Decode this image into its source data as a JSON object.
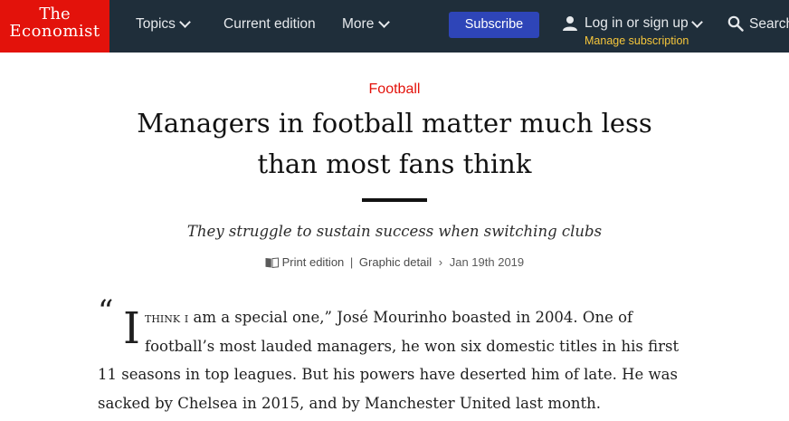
{
  "header": {
    "logo_line1": "The",
    "logo_line2": "Economist",
    "nav": {
      "topics": "Topics",
      "current_edition": "Current edition",
      "more": "More"
    },
    "subscribe": "Subscribe",
    "login": "Log in or sign up",
    "manage": "Manage subscription",
    "search": "Search",
    "colors": {
      "bar": "#1f2e3a",
      "logo": "#e3120b",
      "subscribe": "#2e45b8",
      "manage": "#f6c63b"
    },
    "icons": [
      "chevron-down-icon",
      "user-icon",
      "search-icon"
    ]
  },
  "article": {
    "section": "Football",
    "headline_line1": "Managers in football matter much less",
    "headline_line2": "than most fans think",
    "standfirst": "They struggle to sustain success when switching clubs",
    "meta": {
      "print": "Print edition",
      "sep": "|",
      "graphic": "Graphic detail",
      "arrow": "›",
      "date": "Jan 19th 2019",
      "icon": "book-icon"
    },
    "body": {
      "open_quote": "“",
      "dropcap": "I",
      "line1_smallcaps": "think i",
      "line1_rest": " am a special one,” José Mourinho boasted in 2004. One of",
      "line2": "football’s most lauded managers, he won six domestic titles in his first",
      "line3": "11 seasons in top leagues. But his powers have deserted him of late. He was",
      "line4": "sacked by Chelsea in 2015, and by Manchester United last month."
    }
  }
}
